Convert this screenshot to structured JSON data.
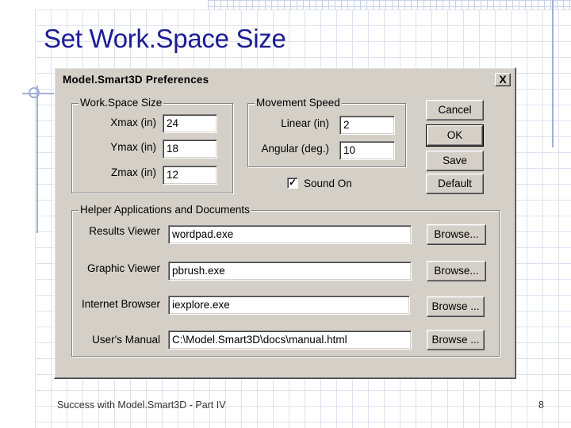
{
  "slide": {
    "title": "Set Work.Space Size",
    "footer": "Success with Model.Smart3D - Part IV",
    "page_number": "8"
  },
  "dialog": {
    "title": "Model.Smart3D Preferences",
    "close_label": "X",
    "workspace": {
      "group_label": "Work.Space Size",
      "xmax_label": "Xmax (in)",
      "xmax_value": "24",
      "ymax_label": "Ymax (in)",
      "ymax_value": "18",
      "zmax_label": "Zmax (in)",
      "zmax_value": "12"
    },
    "movement": {
      "group_label": "Movement Speed",
      "linear_label": "Linear (in)",
      "linear_value": "2",
      "angular_label": "Angular (deg.)",
      "angular_value": "10"
    },
    "sound": {
      "label": "Sound On",
      "checked": true,
      "check_glyph": "✓"
    },
    "buttons": {
      "cancel": "Cancel",
      "ok": "OK",
      "save": "Save",
      "default": "Default"
    },
    "helpers": {
      "group_label": "Helper Applications and Documents",
      "rows": [
        {
          "label": "Results Viewer",
          "value": "wordpad.exe",
          "button": "Browse..."
        },
        {
          "label": "Graphic Viewer",
          "value": "pbrush.exe",
          "button": "Browse..."
        },
        {
          "label": "Internet Browser",
          "value": "iexplore.exe",
          "button": "Browse ..."
        },
        {
          "label": "User's Manual",
          "value": "C:\\Model.Smart3D\\docs\\manual.html",
          "button": "Browse ..."
        }
      ]
    }
  }
}
